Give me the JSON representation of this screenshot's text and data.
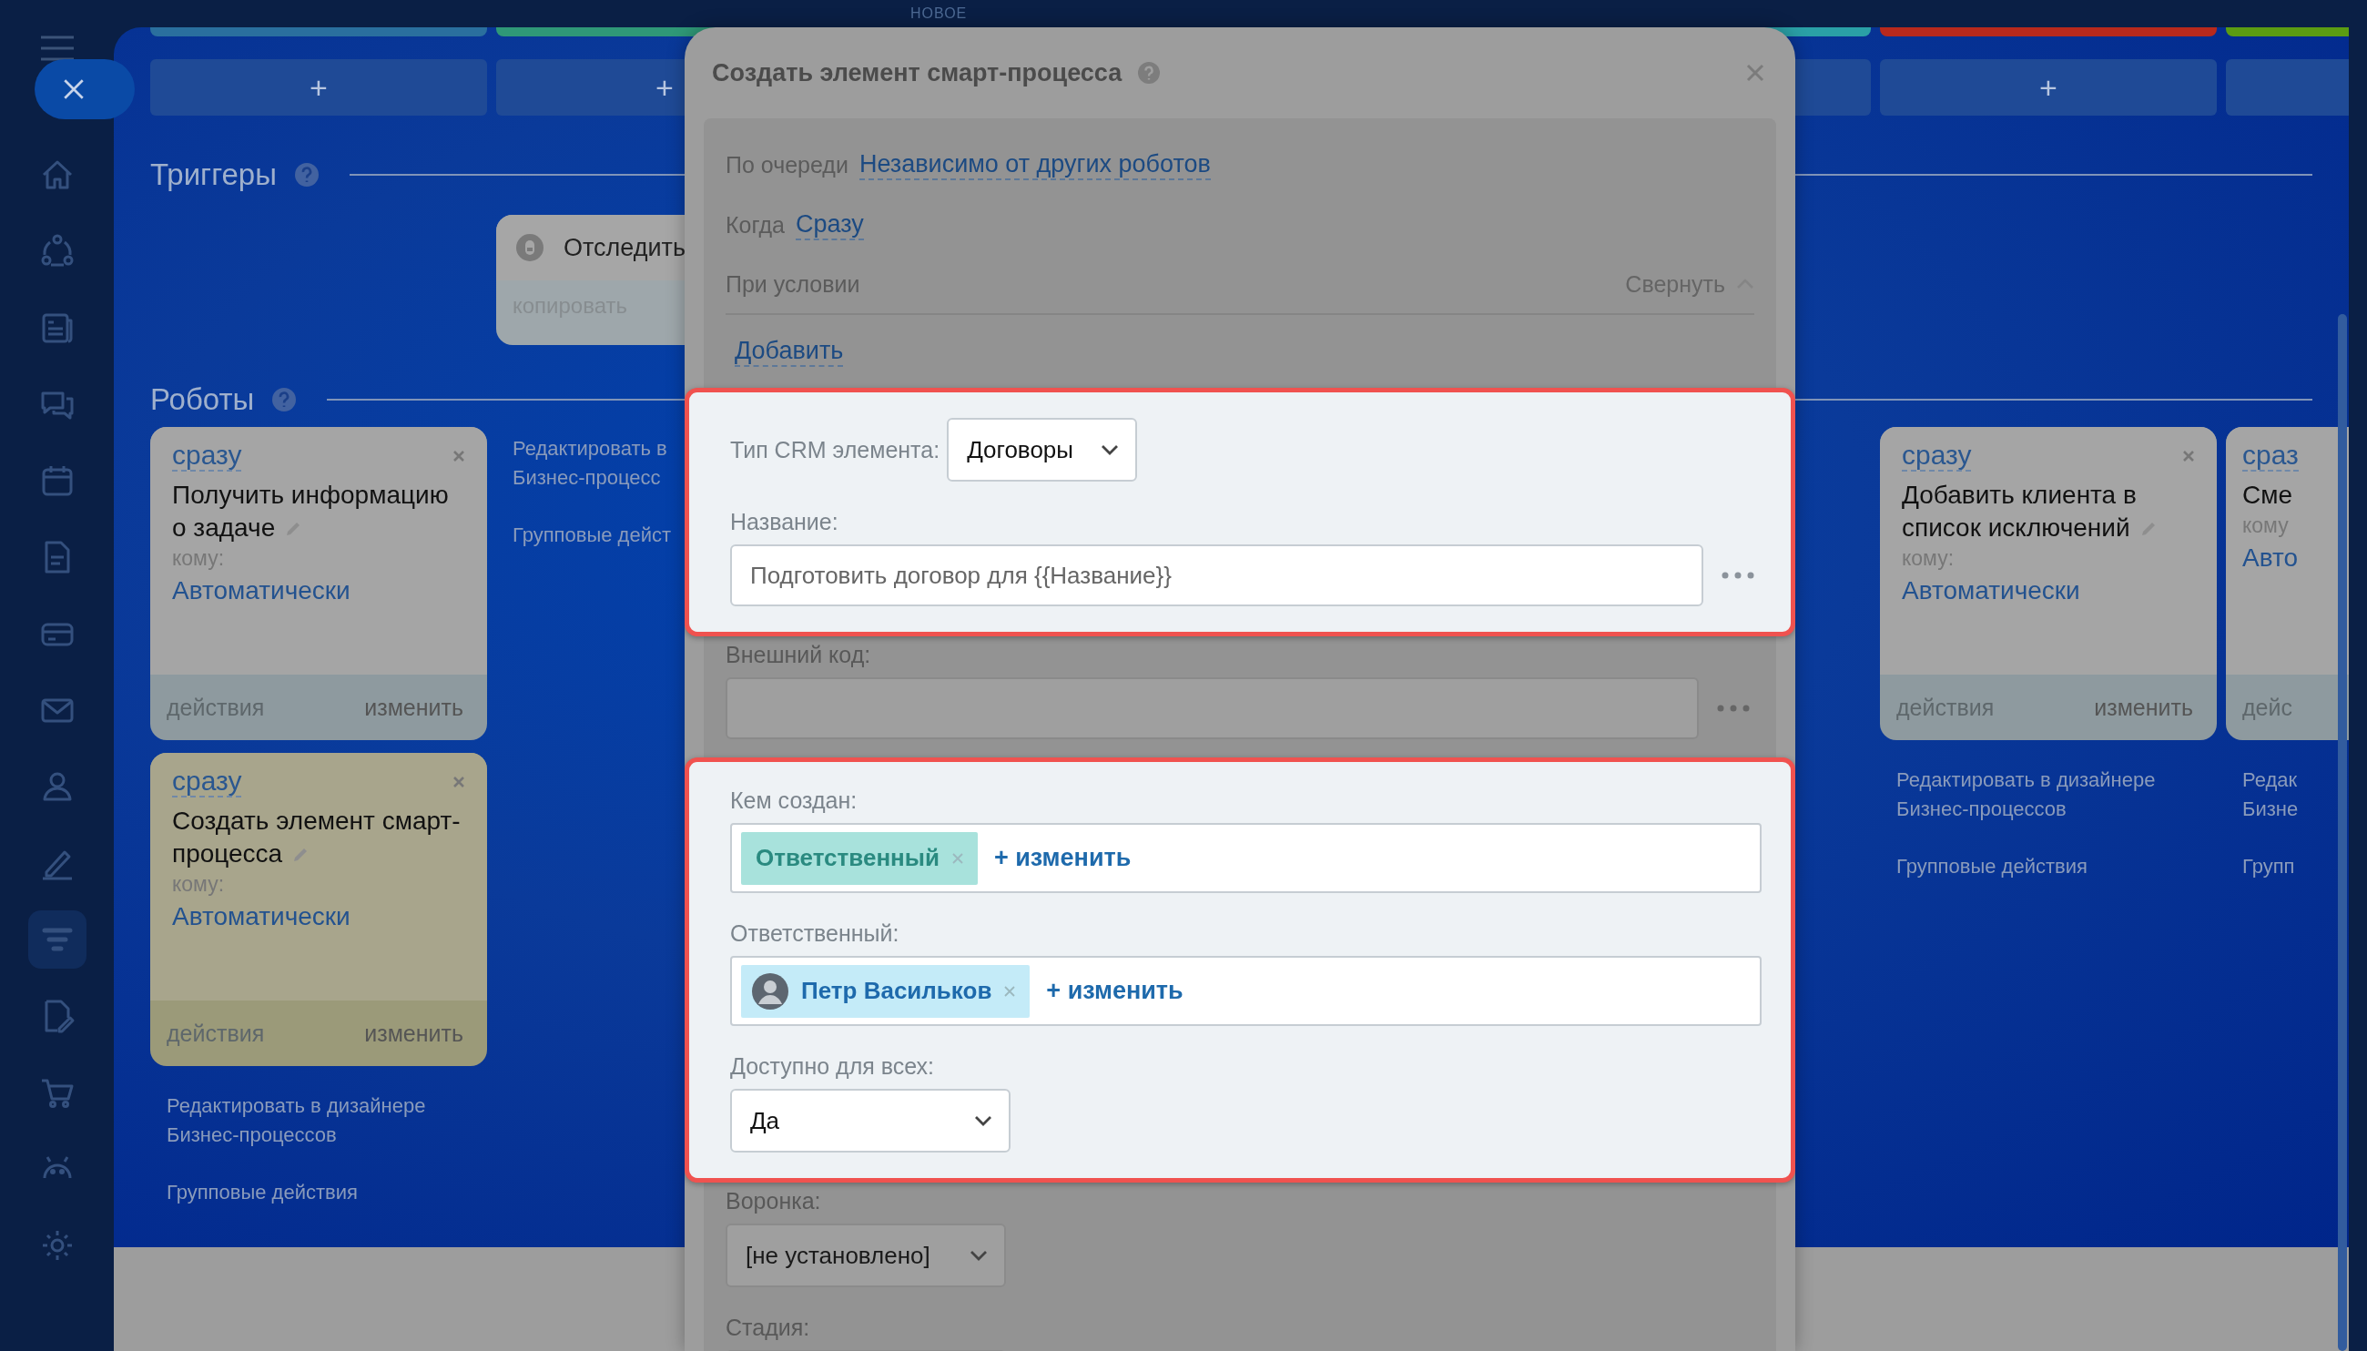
{
  "top_label": "НОВОЕ",
  "sidebar": {
    "items": [
      {
        "selected": false
      },
      {
        "selected": false
      },
      {
        "selected": false
      },
      {
        "selected": false
      },
      {
        "selected": false
      },
      {
        "selected": false
      },
      {
        "selected": false
      },
      {
        "selected": false
      },
      {
        "selected": false
      },
      {
        "selected": false
      },
      {
        "selected": true
      },
      {
        "selected": false
      },
      {
        "selected": false
      },
      {
        "selected": false
      },
      {
        "selected": false
      }
    ]
  },
  "stages": [
    {
      "color": "#2a6f9e",
      "add": "+"
    },
    {
      "color": "#2f9877",
      "add": "+"
    },
    {
      "color": "#2aa0a6"
    },
    {
      "color": "#b8291c",
      "add": "+"
    },
    {
      "color": "#5b9c12"
    }
  ],
  "triggers": {
    "title": "Триггеры",
    "columns": [
      {},
      {
        "card": {
          "title": "Отследить",
          "action": "копировать"
        }
      }
    ]
  },
  "robots": {
    "title": "Роботы",
    "columns": [
      {
        "cards": [
          {
            "when": "сразу",
            "title": "Получить информацию о задаче",
            "to_label": "кому:",
            "to": "Автоматически",
            "actions": "действия",
            "edit": "изменить",
            "selected": false
          },
          {
            "when": "сразу",
            "title": "Создать элемент смарт-процесса",
            "to_label": "кому:",
            "to": "Автоматически",
            "actions": "действия",
            "edit": "изменить",
            "selected": true
          }
        ],
        "design": [
          "Редактировать в дизайнере",
          "Бизнес-процессов"
        ],
        "group": "Групповые действия"
      },
      {
        "design": [
          "Редактировать в",
          "Бизнес-процесс"
        ],
        "group": "Групповые дейст"
      },
      {},
      {},
      {},
      {
        "cards": [
          {
            "when": "сразу",
            "title": "Добавить клиента в список исключений",
            "to_label": "кому:",
            "to": "Автоматически",
            "actions": "действия",
            "edit": "изменить",
            "selected": false
          }
        ],
        "design": [
          "Редактировать в дизайнере",
          "Бизнес-процессов"
        ],
        "group": "Групповые действия"
      },
      {
        "cards": [
          {
            "when": "сраз",
            "title": "Сме",
            "to_label": "кому",
            "to": "Авто",
            "actions": "дейс",
            "selected": false
          }
        ],
        "design": [
          "Редак",
          "Бизне"
        ],
        "group": "Групп"
      }
    ]
  },
  "modal": {
    "title": "Создать элемент смарт-процесса",
    "queue": {
      "label": "По очереди",
      "value": "Независимо от других роботов"
    },
    "when": {
      "label": "Когда",
      "value": "Сразу"
    },
    "condition": {
      "label": "При условии",
      "toggle": "Свернуть",
      "add": "Добавить"
    },
    "sections": [
      {
        "highlighted": true,
        "fields": [
          {
            "kind": "select_inline",
            "label": "Тип CRM элемента:",
            "value": "Договоры"
          },
          {
            "kind": "text",
            "label": "Название:",
            "value": "Подготовить договор для {{Название}}"
          }
        ]
      },
      {
        "highlighted": false,
        "fields": [
          {
            "kind": "text",
            "label": "Внешний код:"
          }
        ]
      },
      {
        "highlighted": true,
        "fields": [
          {
            "kind": "users",
            "label": "Кем создан:",
            "tags": [
              {
                "kind": "role",
                "name": "Ответственный"
              }
            ],
            "change": "+ изменить"
          },
          {
            "kind": "users",
            "label": "Ответственный:",
            "tags": [
              {
                "kind": "person",
                "name": "Петр Васильков"
              }
            ],
            "change": "+ изменить"
          },
          {
            "kind": "select",
            "label": "Доступно для всех:",
            "value": "Да"
          }
        ]
      },
      {
        "highlighted": false,
        "fields": [
          {
            "kind": "select",
            "label": "Воронка:",
            "value": "[не установлено]"
          },
          {
            "kind": "select",
            "label": "Стадия:"
          }
        ]
      }
    ]
  }
}
